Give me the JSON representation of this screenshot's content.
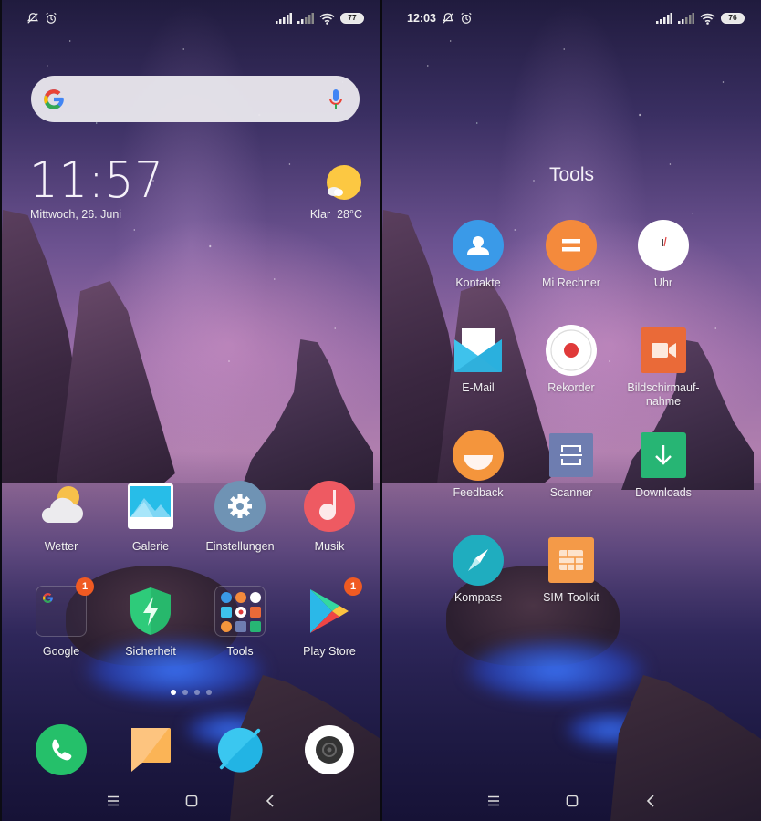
{
  "left_screen": {
    "status_bar": {
      "icons_left": [
        "notifications-off-icon",
        "alarm-icon"
      ],
      "icons_right": [
        "signal-sim1-icon",
        "signal-sim2-icon",
        "wifi-icon"
      ],
      "battery": "77"
    },
    "search": {
      "provider": "Google",
      "placeholder": "",
      "mic": "voice-search"
    },
    "clock": {
      "time": "11:57",
      "date": "Mittwoch, 26. Juni"
    },
    "weather": {
      "condition": "Klar",
      "temperature": "28°C"
    },
    "row1": [
      {
        "label": "Wetter",
        "icon": "weather-icon"
      },
      {
        "label": "Galerie",
        "icon": "gallery-icon"
      },
      {
        "label": "Einstellungen",
        "icon": "settings-icon"
      },
      {
        "label": "Musik",
        "icon": "music-icon"
      }
    ],
    "row2": [
      {
        "label": "Google",
        "icon": "google-folder-icon",
        "badge": "1"
      },
      {
        "label": "Sicherheit",
        "icon": "security-icon"
      },
      {
        "label": "Tools",
        "icon": "tools-folder-icon"
      },
      {
        "label": "Play Store",
        "icon": "play-store-icon",
        "badge": "1"
      }
    ],
    "page_indicator": {
      "pages": 4,
      "active": 1
    },
    "dock": [
      {
        "name": "Telefon",
        "icon": "phone-icon"
      },
      {
        "name": "Nachrichten",
        "icon": "messages-icon"
      },
      {
        "name": "Browser",
        "icon": "browser-icon"
      },
      {
        "name": "Kamera",
        "icon": "camera-icon"
      }
    ],
    "nav": [
      "menu",
      "home",
      "back"
    ]
  },
  "right_screen": {
    "status_bar": {
      "time": "12:03",
      "icons_left": [
        "notifications-off-icon",
        "alarm-icon"
      ],
      "icons_right": [
        "signal-sim1-icon",
        "signal-sim2-icon",
        "wifi-icon"
      ],
      "battery": "76"
    },
    "folder": {
      "title": "Tools",
      "apps": [
        {
          "label": "Kontakte",
          "icon": "contacts-icon"
        },
        {
          "label": "Mi Rechner",
          "icon": "calculator-icon"
        },
        {
          "label": "Uhr",
          "icon": "clock-icon"
        },
        {
          "label": "E-Mail",
          "icon": "email-icon"
        },
        {
          "label": "Rekorder",
          "icon": "recorder-icon"
        },
        {
          "label": "Bildschirmauf-\nnahme",
          "icon": "screen-recorder-icon"
        },
        {
          "label": "Feedback",
          "icon": "feedback-icon"
        },
        {
          "label": "Scanner",
          "icon": "scanner-icon"
        },
        {
          "label": "Downloads",
          "icon": "downloads-icon"
        },
        {
          "label": "Kompass",
          "icon": "compass-icon"
        },
        {
          "label": "SIM-Toolkit",
          "icon": "sim-toolkit-icon"
        }
      ]
    },
    "nav": [
      "menu",
      "home",
      "back"
    ]
  },
  "colors": {
    "badge": "#f05a22",
    "contacts": "#3a9ae8",
    "calculator": "#f48a3c",
    "screen_recorder": "#ea6a38",
    "feedback": "#f4953c",
    "scanner": "#6e7db0",
    "downloads": "#27b574",
    "compass": "#1fadbf",
    "sim_toolkit": "#f49a48",
    "phone": "#25c06a",
    "settings": "#6f93b4",
    "music": "#ee5a62",
    "security": "#2ecb7a"
  }
}
